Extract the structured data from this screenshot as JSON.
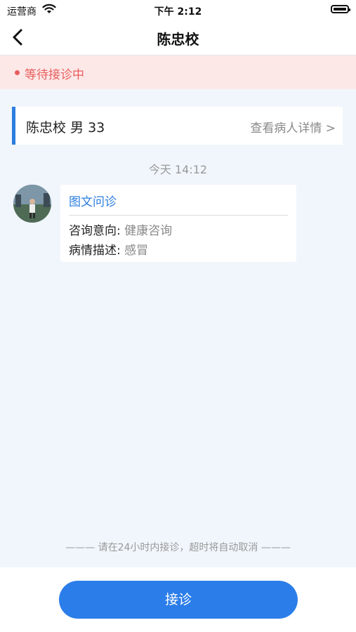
{
  "status_bar": {
    "carrier": "运营商",
    "time": "下午 2:12"
  },
  "nav": {
    "title": "陈忠校"
  },
  "consult_status": {
    "text": "等待接诊中"
  },
  "patient": {
    "info": "陈忠校 男 33",
    "details_link": "查看病人详情 >"
  },
  "chat": {
    "timestamp": "今天 14:12",
    "message": {
      "title": "图文问诊",
      "intent_label": "咨询意向: ",
      "intent_value": "健康咨询",
      "description_label": "病情描述: ",
      "description_value": "感冒"
    }
  },
  "notice": "——— 请在24小时内接诊，超时将自动取消 ———",
  "actions": {
    "accept_label": "接诊"
  },
  "colors": {
    "accent": "#2b7de9",
    "alert": "#e85d5d",
    "alert_bg": "#fde8e8",
    "content_bg": "#f1f6fc"
  },
  "icons": [
    "wifi-icon",
    "battery-icon",
    "back-arrow-icon",
    "avatar"
  ]
}
